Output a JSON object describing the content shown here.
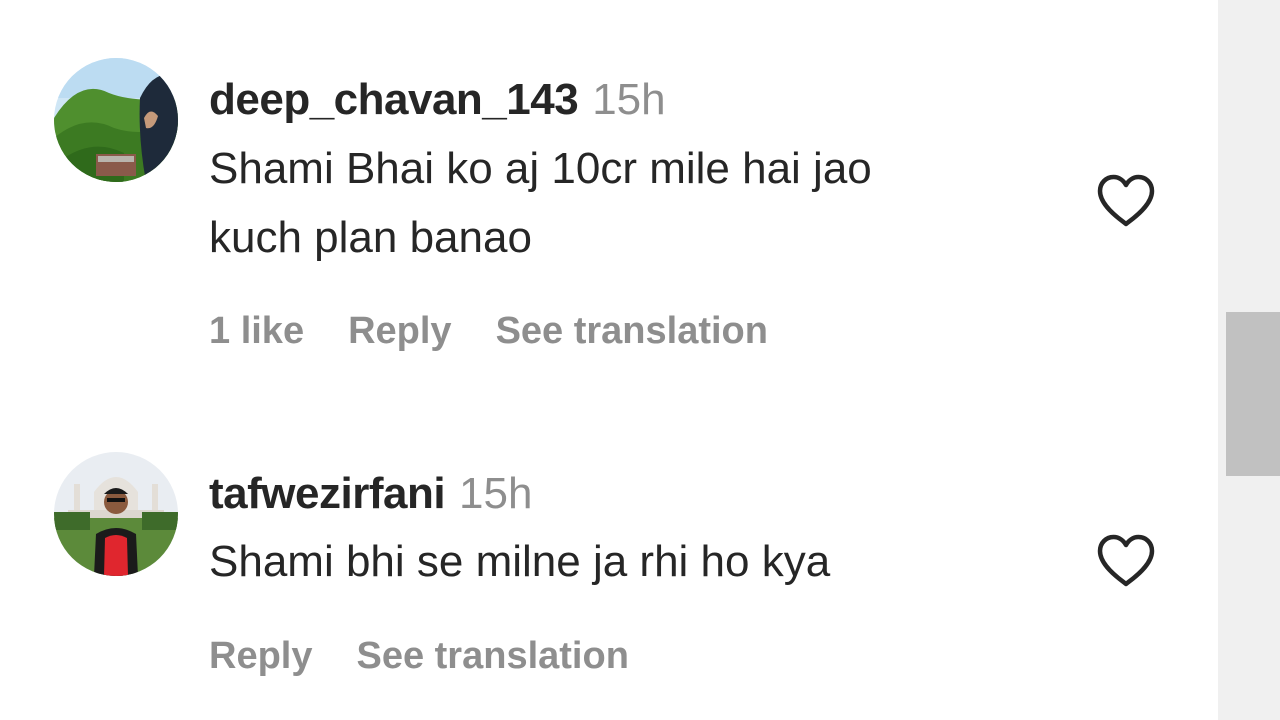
{
  "comments": [
    {
      "username": "deep_chavan_143",
      "time": "15h",
      "text_lines": [
        "Shami Bhai ko aj 10cr mile hai jao",
        "kuch plan banao"
      ],
      "likes": "1 like",
      "reply_label": "Reply",
      "translate_label": "See translation",
      "like_icon": "heart-outline-icon"
    },
    {
      "username": "tafwezirfani",
      "time": "15h",
      "text_lines": [
        "Shami bhi se milne ja rhi ho kya"
      ],
      "reply_label": "Reply",
      "translate_label": "See translation",
      "like_icon": "heart-outline-icon"
    }
  ],
  "colors": {
    "primary_text": "#262626",
    "secondary_text": "#8e8e8e",
    "scrollbar_track": "#f0f0f0",
    "scrollbar_thumb": "#c1c1c1"
  }
}
